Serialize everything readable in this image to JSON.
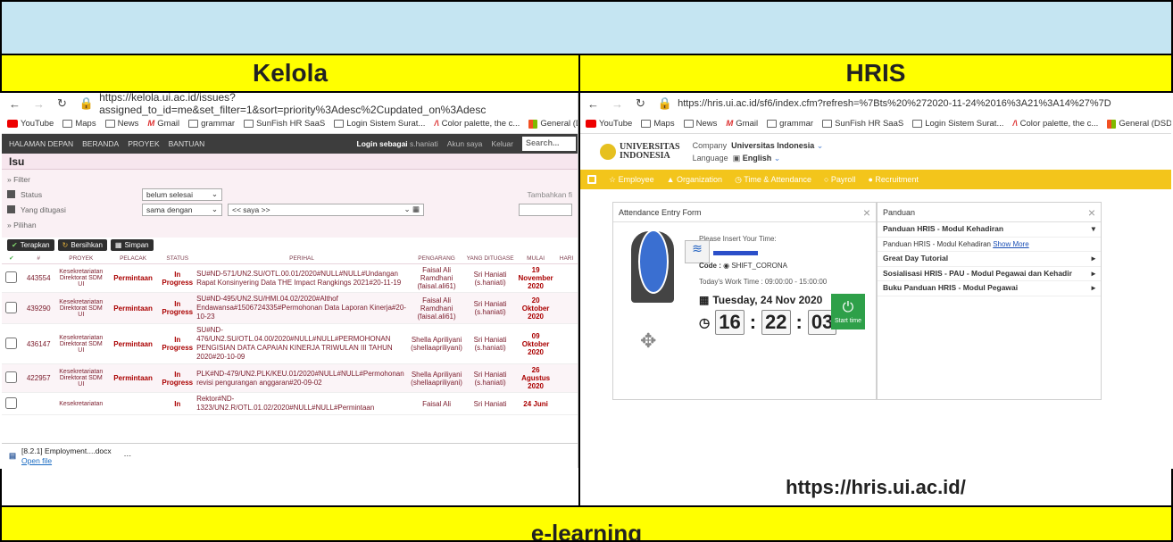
{
  "headers": {
    "left": "Kelola",
    "right": "HRIS"
  },
  "footers": {
    "left": "",
    "right": "https://hris.ui.ac.id/"
  },
  "bottom_title": "e-learning",
  "bookmarks": [
    "YouTube",
    "Maps",
    "News",
    "Gmail",
    "grammar",
    "SunFish HR SaaS",
    "Login Sistem Surat...",
    "Color palette, the c...",
    "General (DSDM) |..."
  ],
  "kelola": {
    "url": "https://kelola.ui.ac.id/issues?assigned_to_id=me&set_filter=1&sort=priority%3Adesc%2Cupdated_on%3Adesc",
    "nav": [
      "HALAMAN DEPAN",
      "BERANDA",
      "PROYEK",
      "BANTUAN"
    ],
    "login_label": "Login sebagai",
    "login_user": "s.haniati",
    "account": "Akun saya",
    "logout": "Keluar",
    "search_placeholder": "Search...",
    "page_title": "Isu",
    "filter_label": "» Filter",
    "filter_status": "Status",
    "filter_status_value": "belum selesai",
    "filter_assigned": "Yang ditugasi",
    "filter_assigned_op": "sama dengan",
    "filter_assigned_value": "<< saya >>",
    "add_filter": "Tambahkan fi",
    "options_label": "» Pilihan",
    "btn_apply": "Terapkan",
    "btn_clear": "Bersihkan",
    "btn_save": "Simpan",
    "columns": [
      "#",
      "PROYEK",
      "PELACAK",
      "STATUS",
      "PERIHAL",
      "PENGARANG",
      "YANG DITUGASE",
      "MULAI",
      "HARI"
    ],
    "rows": [
      {
        "id": "443554",
        "project": "Kesekretariatan Direktorat SDM UI",
        "tracker": "Permintaan",
        "status": "In Progress",
        "subject": "SU#ND-571/UN2.SU/OTL.00.01/2020#NULL#NULL#Undangan Rapat Konsinyering Data THE Impact Rangkings 2021#20-11-19",
        "author": "Faisal Ali Ramdhani (faisal.ali61)",
        "assignee": "Sri Haniati (s.haniati)",
        "start": "19 November 2020"
      },
      {
        "id": "439290",
        "project": "Kesekretariatan Direktorat SDM UI",
        "tracker": "Permintaan",
        "status": "In Progress",
        "subject": "SU#ND-495/UN2.SU/HMI.04.02/2020#Althof Endawansa#1506724335#Permohonan Data Laporan Kinerja#20-10-23",
        "author": "Faisal Ali Ramdhani (faisal.ali61)",
        "assignee": "Sri Haniati (s.haniati)",
        "start": "20 Oktober 2020"
      },
      {
        "id": "436147",
        "project": "Kesekretariatan Direktorat SDM UI",
        "tracker": "Permintaan",
        "status": "In Progress",
        "subject": "SU#ND-476/UN2.SU/OTL.04.00/2020#NULL#NULL#PERMOHONAN PENGISIAN DATA CAPAIAN KINERJA TRIWULAN III TAHUN 2020#20-10-09",
        "author": "Shella Apriliyani (shellaapriliyani)",
        "assignee": "Sri Haniati (s.haniati)",
        "start": "09 Oktober 2020"
      },
      {
        "id": "422957",
        "project": "Kesekretariatan Direktorat SDM UI",
        "tracker": "Permintaan",
        "status": "In Progress",
        "subject": "PLK#ND-479/UN2.PLK/KEU.01/2020#NULL#NULL#Permohonan revisi pengurangan anggaran#20-09-02",
        "author": "Shella Apriliyani (shellaapriliyani)",
        "assignee": "Sri Haniati (s.haniati)",
        "start": "26 Agustus 2020"
      },
      {
        "id": "",
        "project": "Kesekretariatan",
        "tracker": "",
        "status": "In",
        "subject": "Rektor#ND-1323/UN2.R/OTL.01.02/2020#NULL#NULL#Permintaan",
        "author": "Faisal Ali",
        "assignee": "Sri Haniati",
        "start": "24 Juni"
      }
    ],
    "download_file": "[8.2.1] Employment....docx",
    "download_link": "Open file"
  },
  "hris": {
    "url": "https://hris.ui.ac.id/sf6/index.cfm?refresh=%7Bts%20%272020-11-24%2016%3A21%3A14%27%7D",
    "uni_line1": "UNIVERSITAS",
    "uni_line2": "INDONESIA",
    "company_label": "Company",
    "company_value": "Universitas Indonesia",
    "language_label": "Language",
    "language_value": "English",
    "menu": [
      "Employee",
      "Organization",
      "Time & Attendance",
      "Payroll",
      "Recruitment"
    ],
    "attendance_title": "Attendance Entry Form",
    "insert_time": "Please Insert Your Time:",
    "code_label": "Code :",
    "code_value": "SHIFT_CORONA",
    "work_time": "Today's Work Time : 09:00:00 - 15:00:00",
    "date": "Tuesday, 24 Nov 2020",
    "time_h": "16",
    "time_m": "22",
    "time_s": "03",
    "start_btn": "Start time",
    "panduan_title": "Panduan",
    "panduan_items": [
      {
        "title": "Panduan HRIS - Modul Kehadiran",
        "expanded": true,
        "sub": "Panduan HRIS - Modul Kehadiran",
        "link": "Show More"
      },
      {
        "title": "Great Day Tutorial"
      },
      {
        "title": "Sosialisasi HRIS - PAU - Modul Pegawai dan Kehadir"
      },
      {
        "title": "Buku Panduan HRIS - Modul Pegawai"
      }
    ]
  }
}
